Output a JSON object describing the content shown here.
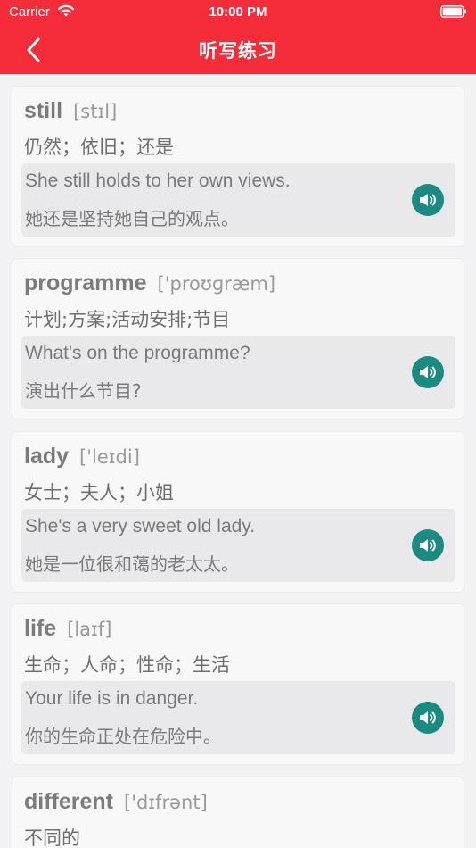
{
  "status_bar": {
    "carrier": "Carrier",
    "time": "10:00 PM"
  },
  "nav": {
    "title": "听写练习",
    "back_icon": "chevron-left-icon"
  },
  "colors": {
    "header": "#f52d3a",
    "speaker": "#1b8a80"
  },
  "words": [
    {
      "word": "still",
      "phonetic": "[stɪl]",
      "meaning": "仍然；依旧；还是",
      "example_en": "She still holds to her own views.",
      "example_zh": "她还是坚持她自己的观点。"
    },
    {
      "word": "programme",
      "phonetic": "['proʊɡræm]",
      "meaning": "计划;方案;活动安排;节目",
      "example_en": "What's on the programme?",
      "example_zh": "演出什么节目?"
    },
    {
      "word": "lady",
      "phonetic": "['leɪdi]",
      "meaning": "女士；夫人；小姐",
      "example_en": "She's a very sweet old lady.",
      "example_zh": "她是一位很和蔼的老太太。"
    },
    {
      "word": "life",
      "phonetic": "[laɪf]",
      "meaning": "生命；人命；性命；生活",
      "example_en": "Your life is in danger.",
      "example_zh": "你的生命正处在危险中。"
    },
    {
      "word": "different",
      "phonetic": "['dɪfrənt]",
      "meaning": "不同的",
      "example_en": "",
      "example_zh": ""
    }
  ]
}
